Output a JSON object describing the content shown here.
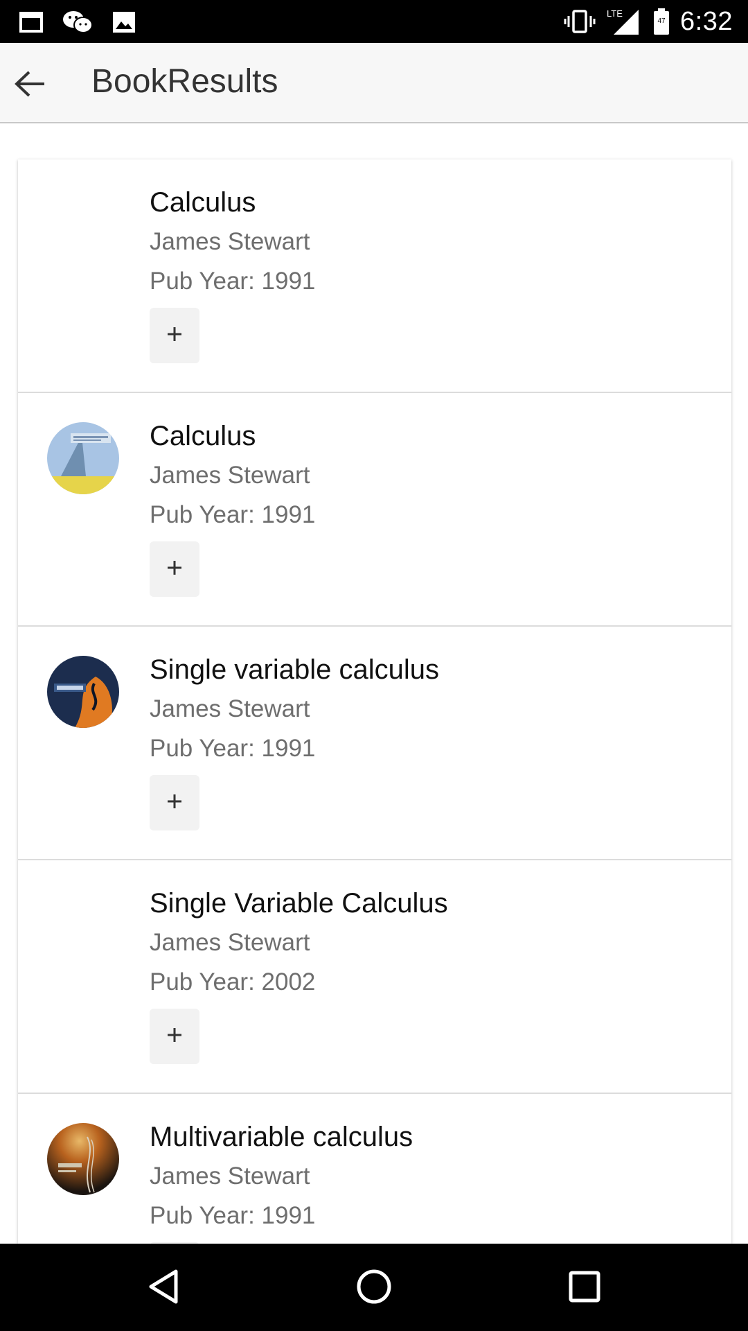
{
  "status_bar": {
    "time": "6:32",
    "left_icons": [
      "window-icon",
      "wechat-icon",
      "image-icon"
    ],
    "right_icons": [
      "vibrate-icon",
      "lte-signal-icon",
      "battery-icon"
    ],
    "network_label": "LTE",
    "battery_level": "47"
  },
  "app_bar": {
    "title": "BookResults",
    "back_icon": "arrow-back-icon"
  },
  "books": [
    {
      "title": "Calculus",
      "author": "James Stewart",
      "year": "Pub Year: 1991",
      "add_label": "+",
      "has_cover": false,
      "cover_colors": []
    },
    {
      "title": "Calculus",
      "author": "James Stewart",
      "year": "Pub Year: 1991",
      "add_label": "+",
      "has_cover": true,
      "cover_colors": [
        "#a8c4e4",
        "#6f8fb0",
        "#e6d44a"
      ]
    },
    {
      "title": "Single variable calculus",
      "author": "James Stewart",
      "year": "Pub Year: 1991",
      "add_label": "+",
      "has_cover": true,
      "cover_colors": [
        "#1c2d4e",
        "#e07a22",
        "#0d1526"
      ]
    },
    {
      "title": "Single Variable Calculus",
      "author": "James Stewart",
      "year": "Pub Year: 2002",
      "add_label": "+",
      "has_cover": false,
      "cover_colors": []
    },
    {
      "title": "Multivariable calculus",
      "author": "James Stewart",
      "year": "Pub Year: 1991",
      "add_label": "+",
      "has_cover": true,
      "cover_colors": [
        "#1a1410",
        "#b8621e",
        "#e8b868"
      ]
    }
  ],
  "nav_bar": {
    "buttons": [
      "back-triangle-icon",
      "home-circle-icon",
      "recents-square-icon"
    ]
  },
  "colors": {
    "status_bar": "#000000",
    "app_bar": "#f7f7f7",
    "title_text": "#333333",
    "secondary_text": "#6e6e6e",
    "add_button_bg": "#f2f2f2"
  }
}
